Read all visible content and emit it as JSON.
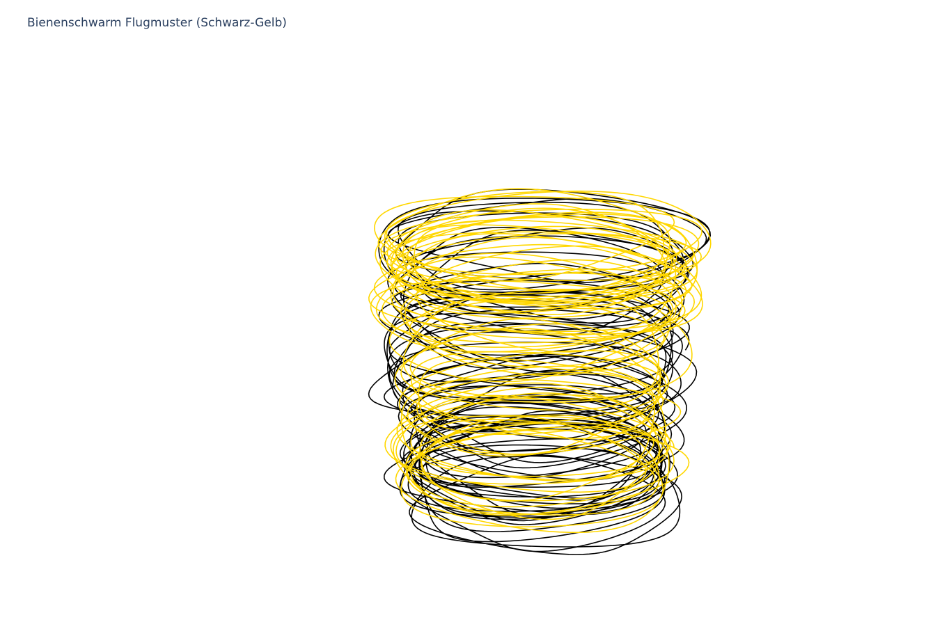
{
  "chart_data": {
    "type": "line",
    "subtype": "3d-line",
    "title": "Bienenschwarm Flugmuster (Schwarz-Gelb)",
    "axes_visible": false,
    "grid": false,
    "legend": "none",
    "series": [
      {
        "color": "#000000",
        "turns": 52,
        "seed": 7
      },
      {
        "color": "#FFD700",
        "turns": 52,
        "seed": 19
      }
    ]
  },
  "colors": {
    "title": "#2a3f5f",
    "background": "#ffffff"
  }
}
